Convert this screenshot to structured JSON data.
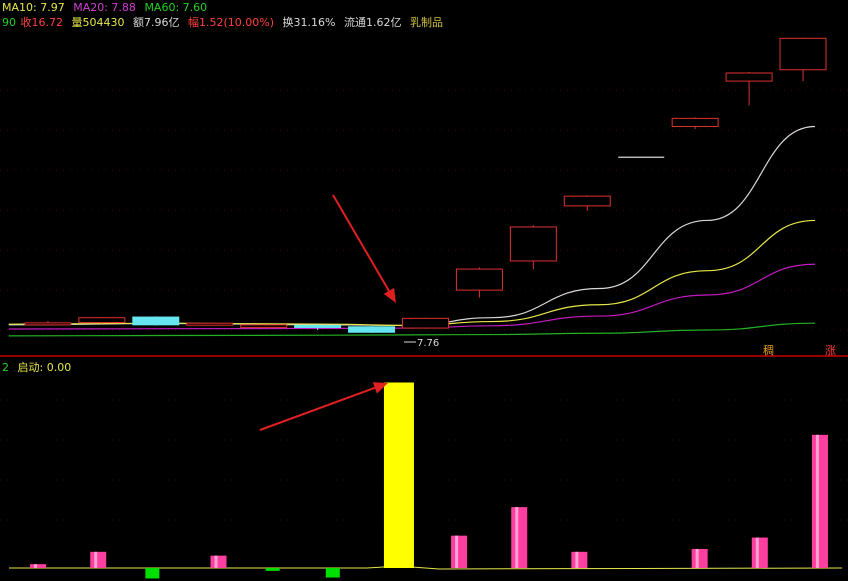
{
  "colors": {
    "ma10": "#d8d8d8",
    "ma20": "#e6e64a",
    "ma60": "#c21bc2",
    "ma_long": "#22b022",
    "candle_up": "#e03030",
    "candle_down": "#66e6f0",
    "doji": "#d8d8d8",
    "vol_up": "#ff3fa0",
    "vol_down": "#00e000",
    "start_bar": "#ffff00",
    "separator": "#cc0000",
    "gridline": "#3a0a0a",
    "arrow": "#e02020",
    "label_yellow": "#e6e64a",
    "label_orange": "#e8a020",
    "label_red": "#ff4040",
    "label_white": "#d8d8d8",
    "label_green": "#22d022",
    "label_magenta": "#d040d0",
    "label_goldenrod": "#d0c040"
  },
  "header_line1": {
    "ma10": "MA10: 7.97",
    "ma20": "MA20: 7.88",
    "ma60": "MA60: 7.60"
  },
  "header_line2": {
    "prefix": "90",
    "close": "收16.72",
    "volume": "量504430",
    "amount": "额7.96亿",
    "change": "幅1.52(10.00%)",
    "turnover": "换31.16%",
    "float_cap": "流通1.62亿",
    "sector": "乳制品"
  },
  "lower_header": {
    "prefix": "2",
    "label": "启动: 0.00"
  },
  "annotations": {
    "low_marker": "7.76",
    "tag_left": "稠",
    "tag_right": "涨"
  },
  "chart_data": [
    {
      "type": "candlestick",
      "candles": [
        {
          "x": 1,
          "open": 7.9,
          "close": 7.94,
          "high": 8.0,
          "low": 7.86
        },
        {
          "x": 2,
          "open": 7.95,
          "close": 8.1,
          "high": 8.12,
          "low": 7.92
        },
        {
          "x": 3,
          "open": 8.12,
          "close": 7.88,
          "high": 8.14,
          "low": 7.86
        },
        {
          "x": 4,
          "open": 7.92,
          "close": 7.93,
          "high": 7.94,
          "low": 7.91
        },
        {
          "x": 5,
          "open": 7.8,
          "close": 7.88,
          "high": 7.89,
          "low": 7.79
        },
        {
          "x": 6,
          "open": 7.86,
          "close": 7.8,
          "high": 7.9,
          "low": 7.72
        },
        {
          "x": 7,
          "open": 7.82,
          "close": 7.65,
          "high": 7.84,
          "low": 7.63
        },
        {
          "x": 8,
          "open": 7.78,
          "close": 8.08,
          "high": 8.1,
          "low": 7.76
        },
        {
          "x": 9,
          "open": 8.95,
          "close": 9.6,
          "high": 9.65,
          "low": 8.72
        },
        {
          "x": 10,
          "open": 9.85,
          "close": 10.9,
          "high": 10.95,
          "low": 9.6
        },
        {
          "x": 11,
          "open": 11.55,
          "close": 11.85,
          "high": 11.88,
          "low": 11.4
        },
        {
          "x": 12,
          "open": 13.05,
          "close": 13.05,
          "high": 13.05,
          "low": 13.05
        },
        {
          "x": 13,
          "open": 14.0,
          "close": 14.25,
          "high": 14.28,
          "low": 13.92
        },
        {
          "x": 14,
          "open": 15.4,
          "close": 15.65,
          "high": 15.68,
          "low": 14.65
        },
        {
          "x": 15,
          "open": 15.75,
          "close": 16.72,
          "high": 16.74,
          "low": 15.4
        }
      ],
      "ma_lines": [
        {
          "name": "MA10",
          "color_key": "ma10",
          "values": [
            [
              0.05,
              7.88
            ],
            [
              3,
              7.92
            ],
            [
              6,
              7.88
            ],
            [
              7.5,
              7.86
            ],
            [
              9,
              8.1
            ],
            [
              11,
              9.0
            ],
            [
              13,
              11.1
            ],
            [
              15,
              14.0
            ]
          ]
        },
        {
          "name": "MA20",
          "color_key": "ma20",
          "values": [
            [
              0.05,
              7.9
            ],
            [
              3,
              7.93
            ],
            [
              6,
              7.9
            ],
            [
              7.5,
              7.86
            ],
            [
              9,
              7.98
            ],
            [
              11,
              8.5
            ],
            [
              13,
              9.55
            ],
            [
              15,
              11.1
            ]
          ]
        },
        {
          "name": "MA60",
          "color_key": "ma60",
          "values": [
            [
              0.05,
              7.75
            ],
            [
              3,
              7.76
            ],
            [
              6,
              7.77
            ],
            [
              7.5,
              7.78
            ],
            [
              9,
              7.85
            ],
            [
              11,
              8.15
            ],
            [
              13,
              8.8
            ],
            [
              15,
              9.75
            ]
          ]
        },
        {
          "name": "",
          "color_key": "ma_long",
          "values": [
            [
              0.05,
              7.54
            ],
            [
              3,
              7.55
            ],
            [
              6,
              7.56
            ],
            [
              7.5,
              7.57
            ],
            [
              9,
              7.58
            ],
            [
              11,
              7.62
            ],
            [
              13,
              7.72
            ],
            [
              15,
              7.93
            ]
          ]
        }
      ],
      "ylim": [
        7.35,
        17.1
      ],
      "xlim": [
        0,
        15.5
      ]
    },
    {
      "type": "bar",
      "bars": [
        {
          "x": 0.6,
          "value": 4,
          "kind": "up"
        },
        {
          "x": 1.6,
          "value": 17,
          "kind": "up"
        },
        {
          "x": 2.5,
          "value": -11,
          "kind": "down"
        },
        {
          "x": 3.6,
          "value": 13,
          "kind": "up"
        },
        {
          "x": 4.5,
          "value": -3,
          "kind": "down"
        },
        {
          "x": 5.5,
          "value": -10,
          "kind": "down"
        },
        {
          "x": 6.6,
          "value": 195,
          "kind": "start"
        },
        {
          "x": 7.6,
          "value": 34,
          "kind": "up"
        },
        {
          "x": 8.6,
          "value": 64,
          "kind": "up"
        },
        {
          "x": 9.6,
          "value": 17,
          "kind": "up"
        },
        {
          "x": 11.6,
          "value": 20,
          "kind": "up"
        },
        {
          "x": 12.6,
          "value": 32,
          "kind": "up"
        },
        {
          "x": 13.6,
          "value": 140,
          "kind": "up"
        }
      ],
      "baseline_line": [
        [
          0.05,
          0
        ],
        [
          6,
          0
        ],
        [
          6.55,
          2
        ],
        [
          7.2,
          -1
        ],
        [
          13.9,
          0
        ]
      ],
      "ylim": [
        -14,
        205
      ],
      "xlim": [
        0,
        14
      ]
    }
  ]
}
